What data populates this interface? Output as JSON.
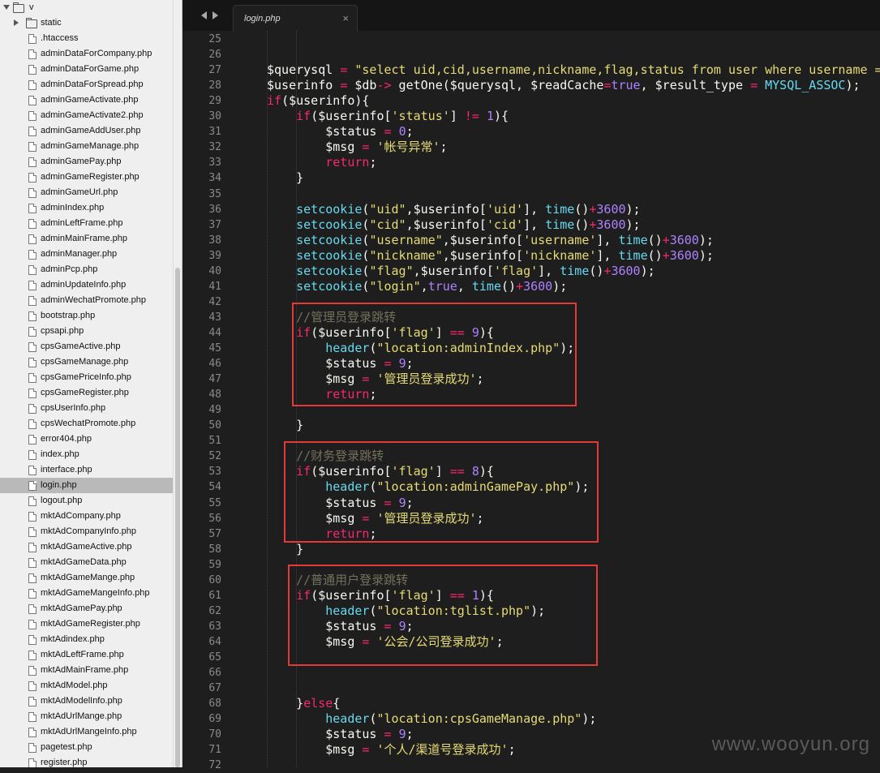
{
  "sidebar": {
    "root_label": "v",
    "folder_label": "static",
    "selected_file": "login.php",
    "files": [
      ".htaccess",
      "adminDataForCompany.php",
      "adminDataForGame.php",
      "adminDataForSpread.php",
      "adminGameActivate.php",
      "adminGameActivate2.php",
      "adminGameAddUser.php",
      "adminGameManage.php",
      "adminGamePay.php",
      "adminGameRegister.php",
      "adminGameUrl.php",
      "adminIndex.php",
      "adminLeftFrame.php",
      "adminMainFrame.php",
      "adminManager.php",
      "adminPcp.php",
      "adminUpdateInfo.php",
      "adminWechatPromote.php",
      "bootstrap.php",
      "cpsapi.php",
      "cpsGameActive.php",
      "cpsGameManage.php",
      "cpsGamePriceInfo.php",
      "cpsGameRegister.php",
      "cpsUserInfo.php",
      "cpsWechatPromote.php",
      "error404.php",
      "index.php",
      "interface.php",
      "login.php",
      "logout.php",
      "mktAdCompany.php",
      "mktAdCompanyInfo.php",
      "mktAdGameActive.php",
      "mktAdGameData.php",
      "mktAdGameMange.php",
      "mktAdGameMangeInfo.php",
      "mktAdGamePay.php",
      "mktAdGameRegister.php",
      "mktAdindex.php",
      "mktAdLeftFrame.php",
      "mktAdMainFrame.php",
      "mktAdModel.php",
      "mktAdModelInfo.php",
      "mktAdUrlMange.php",
      "mktAdUrlMangeInfo.php",
      "pagetest.php",
      "register.php"
    ]
  },
  "tabs": [
    {
      "label": "login.php",
      "close": "×"
    }
  ],
  "editor": {
    "line_numbers": [
      "25",
      "26",
      "27",
      "28",
      "29",
      "30",
      "31",
      "32",
      "33",
      "34",
      "35",
      "36",
      "37",
      "38",
      "39",
      "40",
      "41",
      "42",
      "43",
      "44",
      "45",
      "46",
      "47",
      "48",
      "49",
      "50",
      "51",
      "52",
      "53",
      "54",
      "55",
      "56",
      "57",
      "58",
      "59",
      "60",
      "61",
      "62",
      "63",
      "64",
      "65",
      "66",
      "67",
      "68",
      "69",
      "70",
      "71",
      "72"
    ],
    "lines": [
      [],
      [],
      [
        [
          "v",
          "$querysql "
        ],
        [
          "o",
          "="
        ],
        [
          "v",
          " "
        ],
        [
          "s",
          "\"select uid,cid,username,nickname,flag,status from user where username ="
        ]
      ],
      [
        [
          "v",
          "$userinfo "
        ],
        [
          "o",
          "="
        ],
        [
          "v",
          " $db"
        ],
        [
          "o",
          "->"
        ],
        [
          "v",
          " getOne($querysql, $readCache"
        ],
        [
          "o",
          "="
        ],
        [
          "n",
          "true"
        ],
        [
          "v",
          ", $result_type "
        ],
        [
          "o",
          "="
        ],
        [
          "v",
          " "
        ],
        [
          "cn",
          "MYSQL_ASSOC"
        ],
        [
          "v",
          ");"
        ]
      ],
      [
        [
          "k",
          "if"
        ],
        [
          "v",
          "($userinfo){"
        ]
      ],
      [
        [
          "v",
          "    "
        ],
        [
          "k",
          "if"
        ],
        [
          "v",
          "($userinfo["
        ],
        [
          "s",
          "'status'"
        ],
        [
          "v",
          "] "
        ],
        [
          "o",
          "!="
        ],
        [
          "v",
          " "
        ],
        [
          "n",
          "1"
        ],
        [
          "v",
          "){"
        ]
      ],
      [
        [
          "v",
          "        $status "
        ],
        [
          "o",
          "="
        ],
        [
          "v",
          " "
        ],
        [
          "n",
          "0"
        ],
        [
          "v",
          ";"
        ]
      ],
      [
        [
          "v",
          "        $msg "
        ],
        [
          "o",
          "="
        ],
        [
          "v",
          " "
        ],
        [
          "s",
          "'帐号异常'"
        ],
        [
          "v",
          ";"
        ]
      ],
      [
        [
          "v",
          "        "
        ],
        [
          "k",
          "return"
        ],
        [
          "v",
          ";"
        ]
      ],
      [
        [
          "v",
          "    }"
        ]
      ],
      [],
      [
        [
          "v",
          "    "
        ],
        [
          "f",
          "setcookie"
        ],
        [
          "v",
          "("
        ],
        [
          "s",
          "\"uid\""
        ],
        [
          "v",
          ",$userinfo["
        ],
        [
          "s",
          "'uid'"
        ],
        [
          "v",
          "], "
        ],
        [
          "f",
          "time"
        ],
        [
          "v",
          "()"
        ],
        [
          "o",
          "+"
        ],
        [
          "n",
          "3600"
        ],
        [
          "v",
          ");"
        ]
      ],
      [
        [
          "v",
          "    "
        ],
        [
          "f",
          "setcookie"
        ],
        [
          "v",
          "("
        ],
        [
          "s",
          "\"cid\""
        ],
        [
          "v",
          ",$userinfo["
        ],
        [
          "s",
          "'cid'"
        ],
        [
          "v",
          "], "
        ],
        [
          "f",
          "time"
        ],
        [
          "v",
          "()"
        ],
        [
          "o",
          "+"
        ],
        [
          "n",
          "3600"
        ],
        [
          "v",
          ");"
        ]
      ],
      [
        [
          "v",
          "    "
        ],
        [
          "f",
          "setcookie"
        ],
        [
          "v",
          "("
        ],
        [
          "s",
          "\"username\""
        ],
        [
          "v",
          ",$userinfo["
        ],
        [
          "s",
          "'username'"
        ],
        [
          "v",
          "], "
        ],
        [
          "f",
          "time"
        ],
        [
          "v",
          "()"
        ],
        [
          "o",
          "+"
        ],
        [
          "n",
          "3600"
        ],
        [
          "v",
          ");"
        ]
      ],
      [
        [
          "v",
          "    "
        ],
        [
          "f",
          "setcookie"
        ],
        [
          "v",
          "("
        ],
        [
          "s",
          "\"nickname\""
        ],
        [
          "v",
          ",$userinfo["
        ],
        [
          "s",
          "'nickname'"
        ],
        [
          "v",
          "], "
        ],
        [
          "f",
          "time"
        ],
        [
          "v",
          "()"
        ],
        [
          "o",
          "+"
        ],
        [
          "n",
          "3600"
        ],
        [
          "v",
          ");"
        ]
      ],
      [
        [
          "v",
          "    "
        ],
        [
          "f",
          "setcookie"
        ],
        [
          "v",
          "("
        ],
        [
          "s",
          "\"flag\""
        ],
        [
          "v",
          ",$userinfo["
        ],
        [
          "s",
          "'flag'"
        ],
        [
          "v",
          "], "
        ],
        [
          "f",
          "time"
        ],
        [
          "v",
          "()"
        ],
        [
          "o",
          "+"
        ],
        [
          "n",
          "3600"
        ],
        [
          "v",
          ");"
        ]
      ],
      [
        [
          "v",
          "    "
        ],
        [
          "f",
          "setcookie"
        ],
        [
          "v",
          "("
        ],
        [
          "s",
          "\"login\""
        ],
        [
          "v",
          ","
        ],
        [
          "n",
          "true"
        ],
        [
          "v",
          ", "
        ],
        [
          "f",
          "time"
        ],
        [
          "v",
          "()"
        ],
        [
          "o",
          "+"
        ],
        [
          "n",
          "3600"
        ],
        [
          "v",
          ");"
        ]
      ],
      [],
      [
        [
          "v",
          "    "
        ],
        [
          "c",
          "//管理员登录跳转"
        ]
      ],
      [
        [
          "v",
          "    "
        ],
        [
          "k",
          "if"
        ],
        [
          "v",
          "($userinfo["
        ],
        [
          "s",
          "'flag'"
        ],
        [
          "v",
          "] "
        ],
        [
          "o",
          "=="
        ],
        [
          "v",
          " "
        ],
        [
          "n",
          "9"
        ],
        [
          "v",
          "){"
        ]
      ],
      [
        [
          "v",
          "        "
        ],
        [
          "f",
          "header"
        ],
        [
          "v",
          "("
        ],
        [
          "s",
          "\"location:adminIndex.php\""
        ],
        [
          "v",
          ");"
        ]
      ],
      [
        [
          "v",
          "        $status "
        ],
        [
          "o",
          "="
        ],
        [
          "v",
          " "
        ],
        [
          "n",
          "9"
        ],
        [
          "v",
          ";"
        ]
      ],
      [
        [
          "v",
          "        $msg "
        ],
        [
          "o",
          "="
        ],
        [
          "v",
          " "
        ],
        [
          "s",
          "'管理员登录成功'"
        ],
        [
          "v",
          ";"
        ]
      ],
      [
        [
          "v",
          "        "
        ],
        [
          "k",
          "return"
        ],
        [
          "v",
          ";"
        ]
      ],
      [],
      [
        [
          "v",
          "    }"
        ]
      ],
      [],
      [
        [
          "v",
          "    "
        ],
        [
          "c",
          "//财务登录跳转"
        ]
      ],
      [
        [
          "v",
          "    "
        ],
        [
          "k",
          "if"
        ],
        [
          "v",
          "($userinfo["
        ],
        [
          "s",
          "'flag'"
        ],
        [
          "v",
          "] "
        ],
        [
          "o",
          "=="
        ],
        [
          "v",
          " "
        ],
        [
          "n",
          "8"
        ],
        [
          "v",
          "){"
        ]
      ],
      [
        [
          "v",
          "        "
        ],
        [
          "f",
          "header"
        ],
        [
          "v",
          "("
        ],
        [
          "s",
          "\"location:adminGamePay.php\""
        ],
        [
          "v",
          ");"
        ]
      ],
      [
        [
          "v",
          "        $status "
        ],
        [
          "o",
          "="
        ],
        [
          "v",
          " "
        ],
        [
          "n",
          "9"
        ],
        [
          "v",
          ";"
        ]
      ],
      [
        [
          "v",
          "        $msg "
        ],
        [
          "o",
          "="
        ],
        [
          "v",
          " "
        ],
        [
          "s",
          "'管理员登录成功'"
        ],
        [
          "v",
          ";"
        ]
      ],
      [
        [
          "v",
          "        "
        ],
        [
          "k",
          "return"
        ],
        [
          "v",
          ";"
        ]
      ],
      [
        [
          "v",
          "    }"
        ]
      ],
      [],
      [
        [
          "v",
          "    "
        ],
        [
          "c",
          "//普通用户登录跳转"
        ]
      ],
      [
        [
          "v",
          "    "
        ],
        [
          "k",
          "if"
        ],
        [
          "v",
          "($userinfo["
        ],
        [
          "s",
          "'flag'"
        ],
        [
          "v",
          "] "
        ],
        [
          "o",
          "=="
        ],
        [
          "v",
          " "
        ],
        [
          "n",
          "1"
        ],
        [
          "v",
          "){"
        ]
      ],
      [
        [
          "v",
          "        "
        ],
        [
          "f",
          "header"
        ],
        [
          "v",
          "("
        ],
        [
          "s",
          "\"location:tglist.php\""
        ],
        [
          "v",
          ");"
        ]
      ],
      [
        [
          "v",
          "        $status "
        ],
        [
          "o",
          "="
        ],
        [
          "v",
          " "
        ],
        [
          "n",
          "9"
        ],
        [
          "v",
          ";"
        ]
      ],
      [
        [
          "v",
          "        $msg "
        ],
        [
          "o",
          "="
        ],
        [
          "v",
          " "
        ],
        [
          "s",
          "'公会/公司登录成功'"
        ],
        [
          "v",
          ";"
        ]
      ],
      [],
      [],
      [],
      [
        [
          "v",
          "    }"
        ],
        [
          "k",
          "else"
        ],
        [
          "v",
          "{"
        ]
      ],
      [
        [
          "v",
          "        "
        ],
        [
          "f",
          "header"
        ],
        [
          "v",
          "("
        ],
        [
          "s",
          "\"location:cpsGameManage.php\""
        ],
        [
          "v",
          ");"
        ]
      ],
      [
        [
          "v",
          "        $status "
        ],
        [
          "o",
          "="
        ],
        [
          "v",
          " "
        ],
        [
          "n",
          "9"
        ],
        [
          "v",
          ";"
        ]
      ],
      [
        [
          "v",
          "        $msg "
        ],
        [
          "o",
          "="
        ],
        [
          "v",
          " "
        ],
        [
          "s",
          "'个人/渠道号登录成功'"
        ],
        [
          "v",
          ";"
        ]
      ],
      []
    ]
  },
  "watermark": "www.wooyun.org",
  "colors": {
    "highlight_box": "#e53935",
    "selected_row": "#b9b9b9",
    "editor_bg": "#1e1e1e"
  }
}
